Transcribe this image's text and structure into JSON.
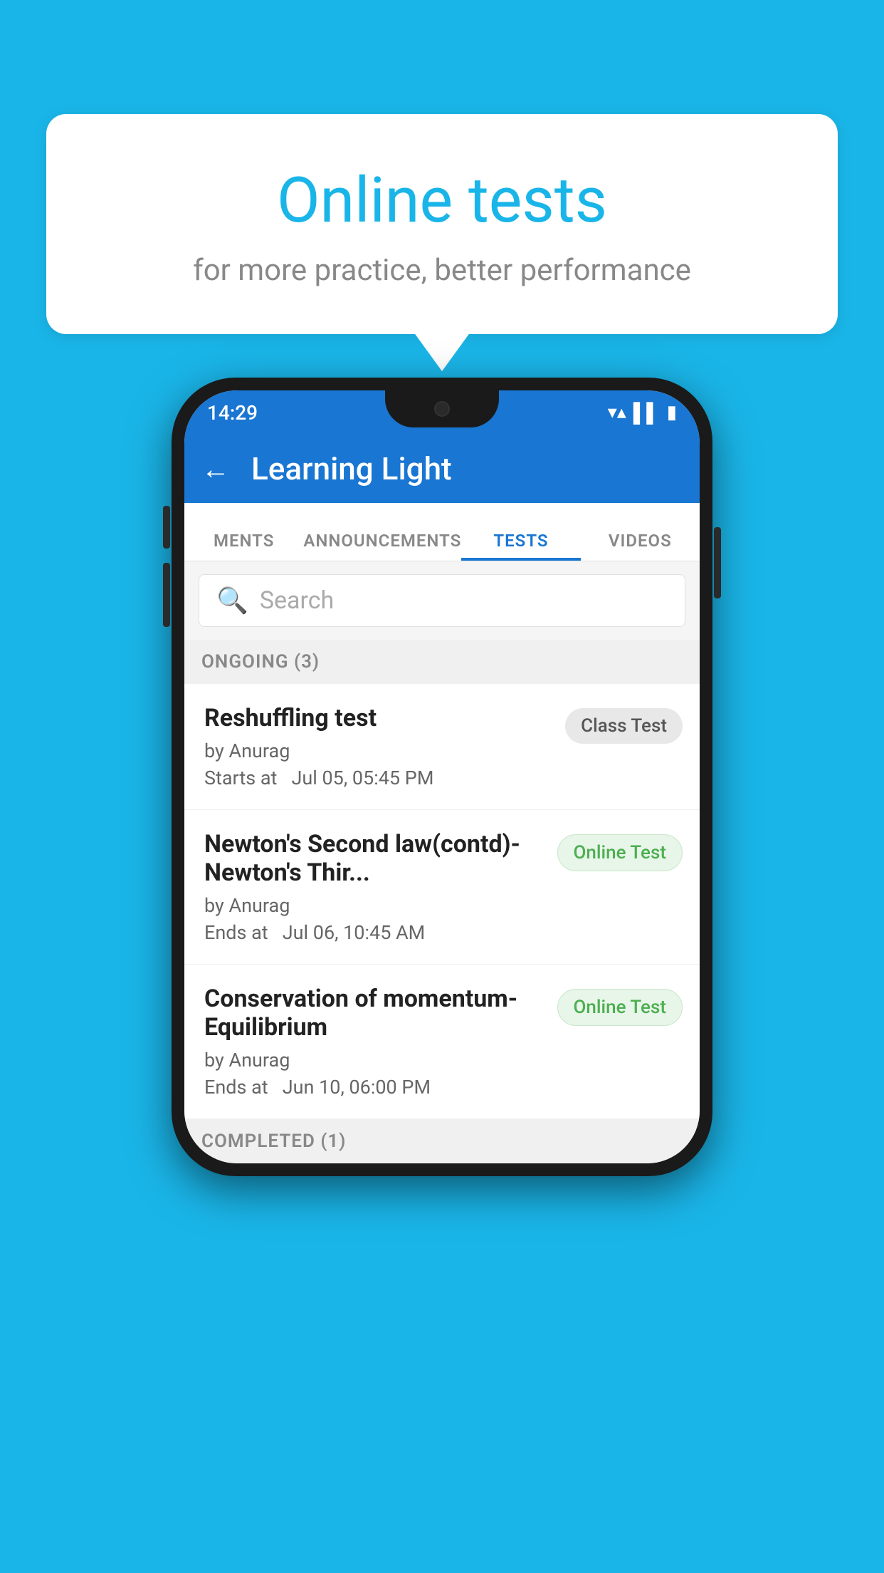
{
  "background_color": "#1ab5e8",
  "speech_bubble": {
    "title": "Online tests",
    "subtitle": "for more practice, better performance"
  },
  "phone": {
    "status_bar": {
      "time": "14:29",
      "wifi_icon": "▼",
      "signal_icon": "▲",
      "battery_icon": "▮"
    },
    "app_bar": {
      "back_label": "←",
      "title": "Learning Light"
    },
    "tabs": [
      {
        "label": "MENTS",
        "active": false
      },
      {
        "label": "ANNOUNCEMENTS",
        "active": false
      },
      {
        "label": "TESTS",
        "active": true
      },
      {
        "label": "VIDEOS",
        "active": false
      }
    ],
    "search": {
      "placeholder": "Search"
    },
    "ongoing_section": {
      "label": "ONGOING (3)"
    },
    "tests": [
      {
        "name": "Reshuffling test",
        "by": "by Anurag",
        "time_label": "Starts at",
        "time": "Jul 05, 05:45 PM",
        "badge": "Class Test",
        "badge_type": "class"
      },
      {
        "name": "Newton's Second law(contd)-Newton's Thir...",
        "by": "by Anurag",
        "time_label": "Ends at",
        "time": "Jul 06, 10:45 AM",
        "badge": "Online Test",
        "badge_type": "online"
      },
      {
        "name": "Conservation of momentum-Equilibrium",
        "by": "by Anurag",
        "time_label": "Ends at",
        "time": "Jun 10, 06:00 PM",
        "badge": "Online Test",
        "badge_type": "online"
      }
    ],
    "completed_section": {
      "label": "COMPLETED (1)"
    }
  }
}
